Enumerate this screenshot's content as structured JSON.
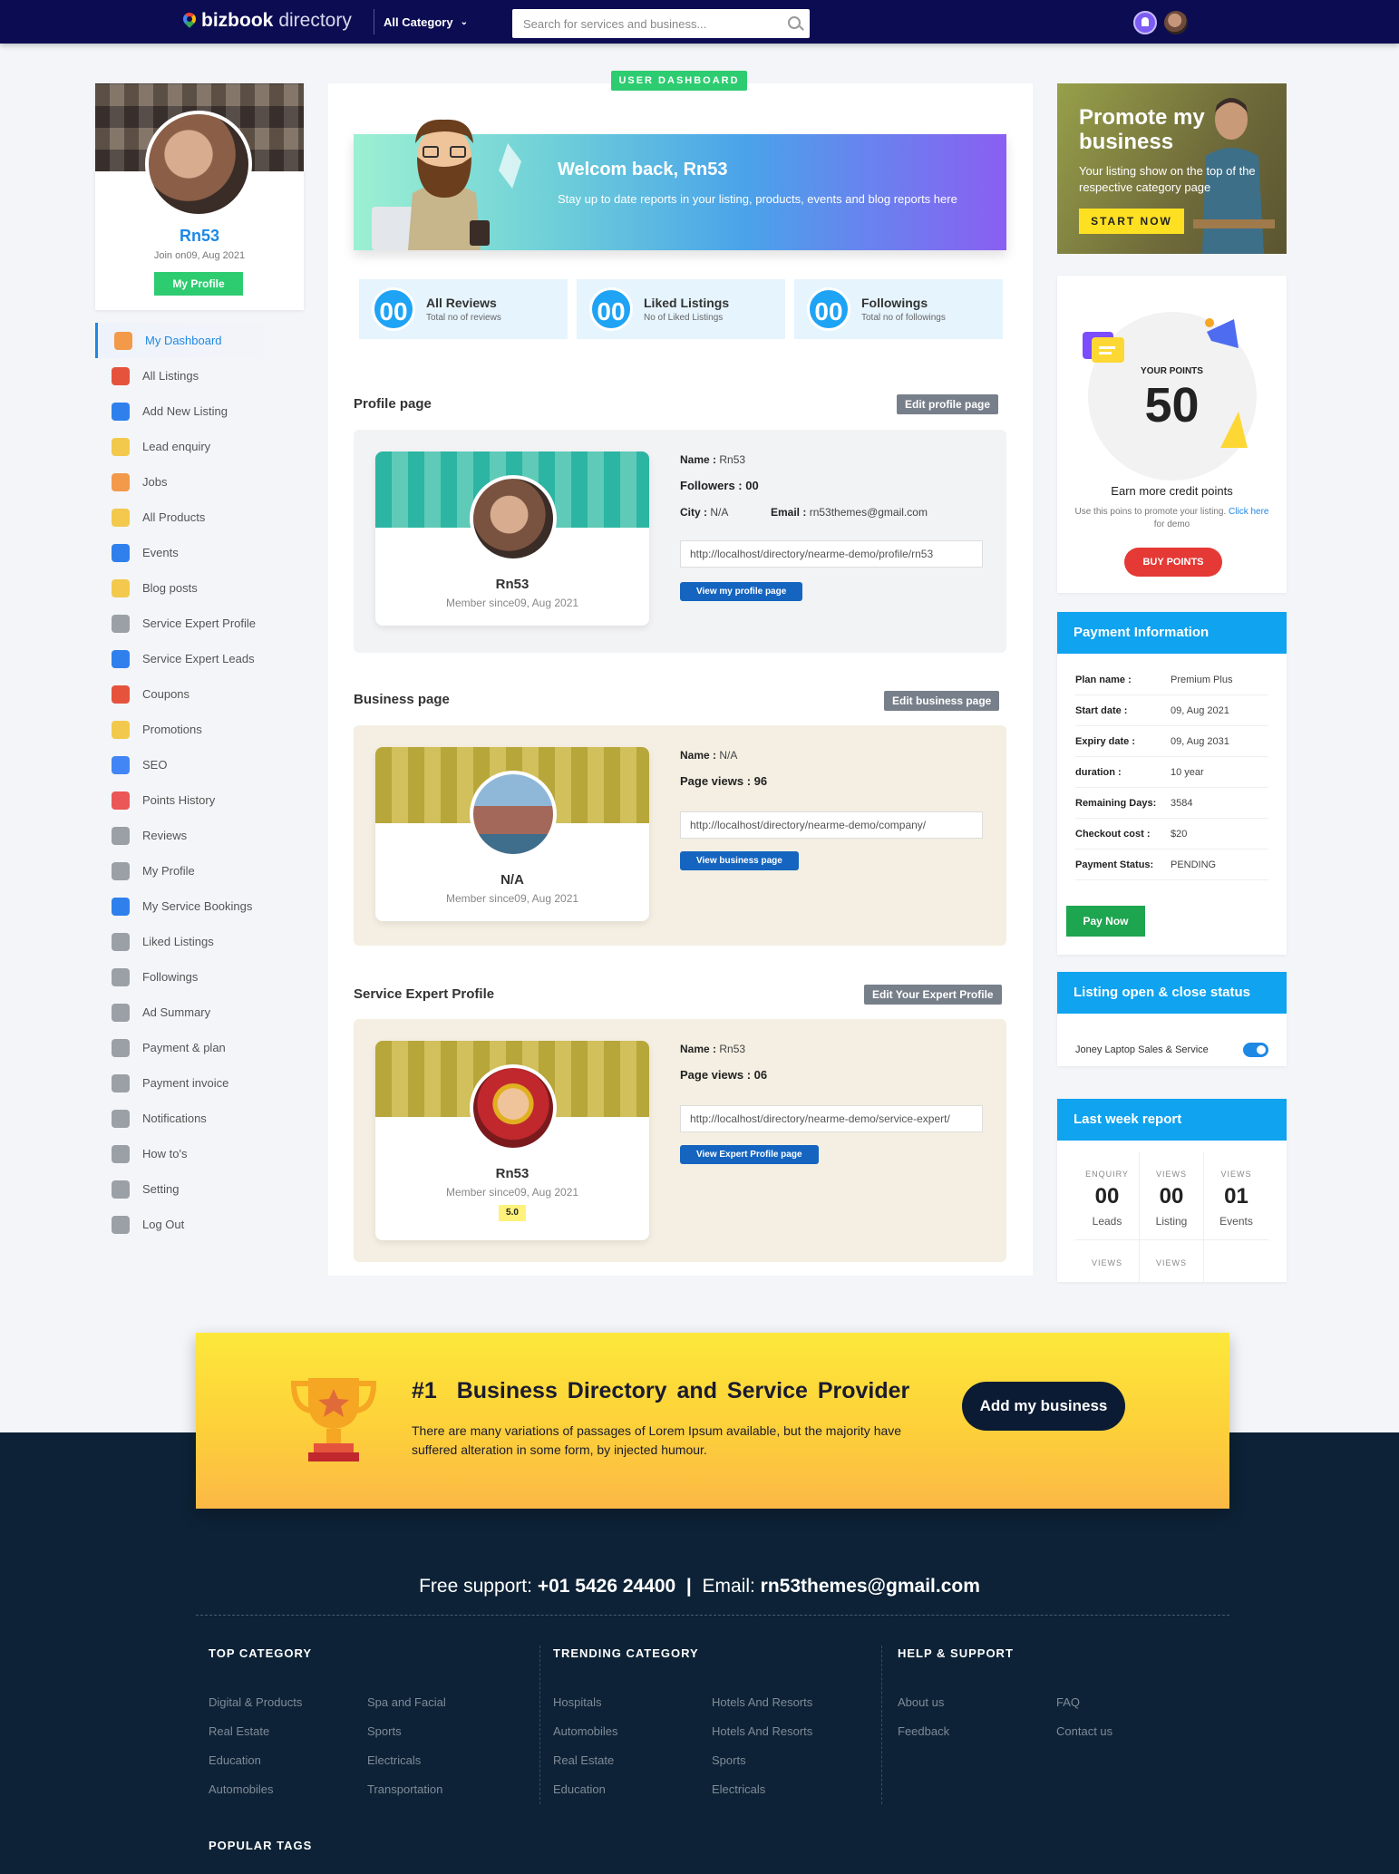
{
  "topbar": {
    "logo_bold": "bizbook",
    "logo_light": "directory",
    "category": "All Category",
    "search_placeholder": "Search for services and business..."
  },
  "profile": {
    "name": "Rn53",
    "joined": "Join on09, Aug 2021",
    "button": "My Profile"
  },
  "menu": [
    {
      "label": "My Dashboard",
      "icon": "dashboard-icon",
      "color": "#f2994a"
    },
    {
      "label": "All Listings",
      "icon": "listings-icon",
      "color": "#e5533d"
    },
    {
      "label": "Add New Listing",
      "icon": "add-listing-icon",
      "color": "#2f80ed"
    },
    {
      "label": "Lead enquiry",
      "icon": "lead-icon",
      "color": "#f2c94c"
    },
    {
      "label": "Jobs",
      "icon": "jobs-icon",
      "color": "#f2994a"
    },
    {
      "label": "All Products",
      "icon": "products-icon",
      "color": "#f2c94c"
    },
    {
      "label": "Events",
      "icon": "events-icon",
      "color": "#2f80ed"
    },
    {
      "label": "Blog posts",
      "icon": "blog-icon",
      "color": "#f2c94c"
    },
    {
      "label": "Service Expert Profile",
      "icon": "expert-icon",
      "color": "#9aa0a6"
    },
    {
      "label": "Service Expert Leads",
      "icon": "expert-leads-icon",
      "color": "#2f80ed"
    },
    {
      "label": "Coupons",
      "icon": "coupons-icon",
      "color": "#e5533d"
    },
    {
      "label": "Promotions",
      "icon": "promotions-icon",
      "color": "#f2c94c"
    },
    {
      "label": "SEO",
      "icon": "google-icon",
      "color": "#4285f4"
    },
    {
      "label": "Points History",
      "icon": "points-icon",
      "color": "#eb5757"
    },
    {
      "label": "Reviews",
      "icon": "reviews-icon",
      "color": "#9aa0a6"
    },
    {
      "label": "My Profile",
      "icon": "profile-icon",
      "color": "#9aa0a6"
    },
    {
      "label": "My Service Bookings",
      "icon": "bookings-icon",
      "color": "#2f80ed"
    },
    {
      "label": "Liked Listings",
      "icon": "heart-icon",
      "color": "#9aa0a6"
    },
    {
      "label": "Followings",
      "icon": "followings-icon",
      "color": "#9aa0a6"
    },
    {
      "label": "Ad Summary",
      "icon": "ad-icon",
      "color": "#9aa0a6"
    },
    {
      "label": "Payment & plan",
      "icon": "payment-icon",
      "color": "#9aa0a6"
    },
    {
      "label": "Payment invoice",
      "icon": "invoice-icon",
      "color": "#9aa0a6"
    },
    {
      "label": "Notifications",
      "icon": "bell-icon",
      "color": "#9aa0a6"
    },
    {
      "label": "How to's",
      "icon": "help-icon",
      "color": "#9aa0a6"
    },
    {
      "label": "Setting",
      "icon": "gear-icon",
      "color": "#9aa0a6"
    },
    {
      "label": "Log Out",
      "icon": "logout-icon",
      "color": "#9aa0a6"
    }
  ],
  "dashboard": {
    "badge": "USER DASHBOARD",
    "welcome": "Welcom back, Rn53",
    "welcome_sub": "Stay up to date reports in your listing, products, events and blog reports here",
    "stats": [
      {
        "value": "00",
        "title": "All Reviews",
        "sub": "Total no of reviews"
      },
      {
        "value": "00",
        "title": "Liked Listings",
        "sub": "No of Liked Listings"
      },
      {
        "value": "00",
        "title": "Followings",
        "sub": "Total no of followings"
      }
    ]
  },
  "profile_page": {
    "heading": "Profile page",
    "edit": "Edit profile page",
    "card_name": "Rn53",
    "card_since": "Member since09, Aug 2021",
    "name_label": "Name :",
    "name_value": "Rn53",
    "followers": "Followers : 00",
    "city_label": "City :",
    "city_value": "N/A",
    "email_label": "Email :",
    "email_value": "rn53themes@gmail.com",
    "url": "http://localhost/directory/nearme-demo/profile/rn53",
    "view": "View my profile page"
  },
  "business_page": {
    "heading": "Business page",
    "edit": "Edit business page",
    "card_name": "N/A",
    "card_since": "Member since09, Aug 2021",
    "name_label": "Name :",
    "name_value": "N/A",
    "views": "Page views : 96",
    "url": "http://localhost/directory/nearme-demo/company/",
    "view": "View business page"
  },
  "expert_page": {
    "heading": "Service Expert Profile",
    "edit": "Edit Your Expert Profile",
    "card_name": "Rn53",
    "card_since": "Member since09, Aug 2021",
    "rating": "5.0",
    "name_label": "Name :",
    "name_value": "Rn53",
    "views": "Page views : 06",
    "url": "http://localhost/directory/nearme-demo/service-expert/",
    "view": "View Expert Profile page"
  },
  "promo": {
    "title": "Promote my business",
    "text": "Your listing show on the top of the respective category page",
    "button": "START NOW"
  },
  "points": {
    "label": "YOUR POINTS",
    "value": "50",
    "earn": "Earn more credit points",
    "desc_pre": "Use this poins to promote your listing.",
    "link": "Click here",
    "desc_post": "for demo",
    "button": "BUY POINTS"
  },
  "payment": {
    "title": "Payment Information",
    "rows": [
      {
        "k": "Plan name :",
        "v": "Premium Plus"
      },
      {
        "k": "Start date :",
        "v": "09, Aug 2021"
      },
      {
        "k": "Expiry date :",
        "v": "09, Aug 2031"
      },
      {
        "k": "duration :",
        "v": "10 year"
      },
      {
        "k": "Remaining Days:",
        "v": "3584"
      },
      {
        "k": "Checkout cost :",
        "v": "$20"
      },
      {
        "k": "Payment Status:",
        "v": "PENDING"
      }
    ],
    "button": "Pay Now"
  },
  "listing_status": {
    "title": "Listing open & close status",
    "item": "Joney Laptop Sales & Service",
    "enabled": true
  },
  "report": {
    "title": "Last week report",
    "cells": [
      {
        "top": "ENQUIRY",
        "value": "00",
        "bottom": "Leads"
      },
      {
        "top": "VIEWS",
        "value": "00",
        "bottom": "Listing"
      },
      {
        "top": "VIEWS",
        "value": "01",
        "bottom": "Events"
      },
      {
        "top": "VIEWS",
        "value": "",
        "bottom": ""
      },
      {
        "top": "VIEWS",
        "value": "",
        "bottom": ""
      },
      {
        "top": "",
        "value": "",
        "bottom": ""
      }
    ]
  },
  "cta": {
    "heading": "#1  Business Directory and Service Provider",
    "text": "There are many variations of passages of Lorem Ipsum available, but the majority have suffered alteration in some form, by injected humour.",
    "button": "Add my business"
  },
  "footer": {
    "support_label": "Free support:",
    "phone": "+01 5426 24400",
    "sep": "|",
    "email_label": "Email:",
    "email": "rn53themes@gmail.com",
    "top_category": "TOP CATEGORY",
    "top_links": [
      "Digital & Products",
      "Spa and Facial",
      "Real Estate",
      "Sports",
      "Education",
      "Electricals",
      "Automobiles",
      "Transportation"
    ],
    "trending_category": "TRENDING CATEGORY",
    "trending_links": [
      "Hospitals",
      "Hotels And Resorts",
      "Automobiles",
      "Hotels And Resorts",
      "Real Estate",
      "Sports",
      "Education",
      "Electricals"
    ],
    "help": "HELP & SUPPORT",
    "help_links": [
      "About us",
      "FAQ",
      "Feedback",
      "Contact us"
    ],
    "popular_tags": "POPULAR TAGS"
  },
  "colors": {
    "nav": "#0c0c53",
    "accent": "#1e88e5",
    "green": "#2ecc71",
    "footer": "#0d2236"
  }
}
